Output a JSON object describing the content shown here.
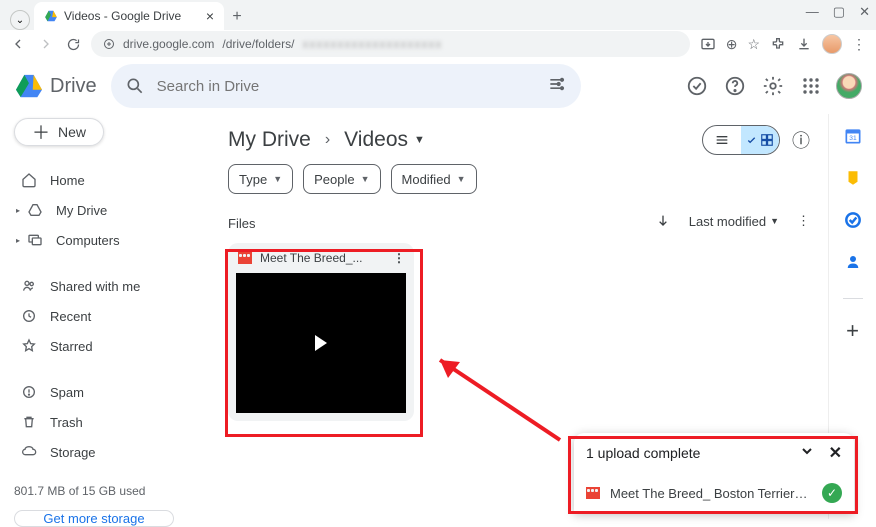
{
  "browser": {
    "tab_title": "Videos - Google Drive",
    "url_host": "drive.google.com",
    "url_path": "/drive/folders/"
  },
  "app": {
    "name": "Drive",
    "search_placeholder": "Search in Drive"
  },
  "sidebar": {
    "new_label": "New",
    "items": [
      {
        "label": "Home",
        "icon": "home"
      },
      {
        "label": "My Drive",
        "icon": "drive"
      },
      {
        "label": "Computers",
        "icon": "computers"
      }
    ],
    "items2": [
      {
        "label": "Shared with me",
        "icon": "shared"
      },
      {
        "label": "Recent",
        "icon": "recent"
      },
      {
        "label": "Starred",
        "icon": "starred"
      }
    ],
    "items3": [
      {
        "label": "Spam",
        "icon": "spam"
      },
      {
        "label": "Trash",
        "icon": "trash"
      },
      {
        "label": "Storage",
        "icon": "storage"
      }
    ],
    "storage_text": "801.7 MB of 15 GB used",
    "get_more": "Get more storage"
  },
  "breadcrumb": {
    "root": "My Drive",
    "current": "Videos"
  },
  "filters": {
    "type": "Type",
    "people": "People",
    "modified": "Modified"
  },
  "section_label": "Files",
  "sort": {
    "label": "Last modified"
  },
  "file": {
    "name": "Meet The Breed_..."
  },
  "toast": {
    "header": "1 upload complete",
    "file": "Meet The Breed_ Boston Terriers, The ..."
  }
}
